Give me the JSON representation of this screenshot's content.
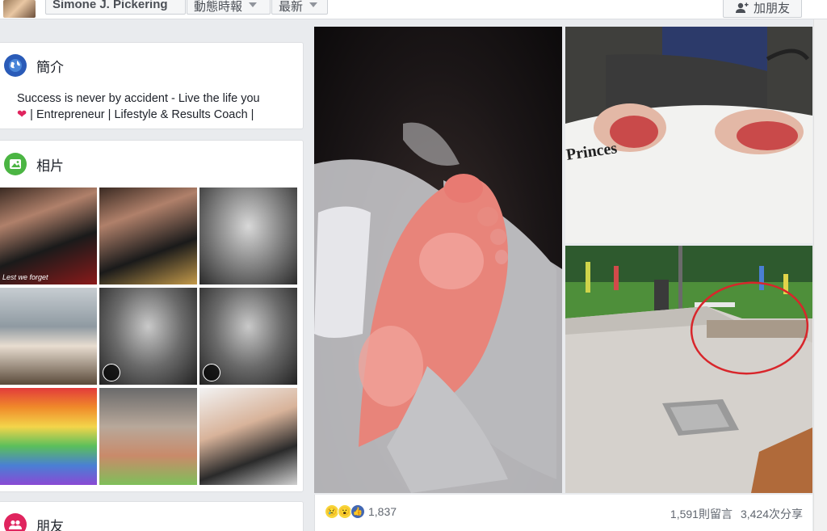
{
  "header": {
    "profile_name": "Simone J. Pickering",
    "filter_label": "動態時報",
    "sort_label": "最新",
    "add_friend_label": "加朋友"
  },
  "intro": {
    "title": "簡介",
    "bio_line1": "Success is never by accident - Live the life you",
    "heart": "❤",
    "bio_line2": " | Entrepreneur | Lifestyle & Results Coach |"
  },
  "photos": {
    "title": "相片",
    "first_caption": "Lest we forget"
  },
  "friends": {
    "title": "朋友"
  },
  "post": {
    "brand_towel": "Princes",
    "reaction_count": "1,837",
    "comments": "1,591則留言",
    "shares": "3,424次分享"
  },
  "colors": {
    "brand_blue": "#4267b2",
    "intro_icon": "#2a5bb8",
    "photos_icon": "#4bb543",
    "friends_icon": "#e0245e",
    "annotation_red": "#d8262b"
  }
}
